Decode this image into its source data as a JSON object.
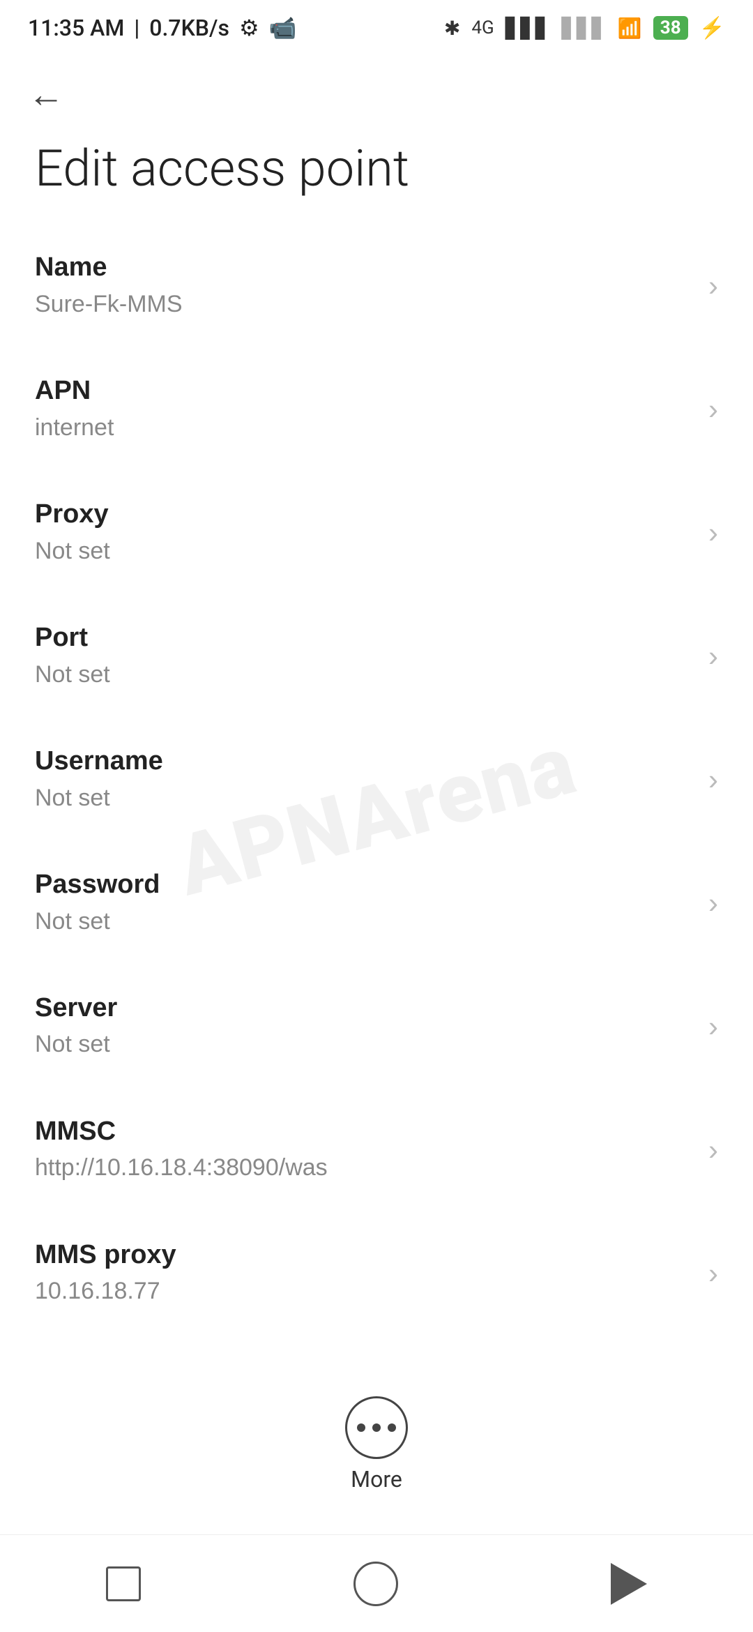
{
  "statusBar": {
    "time": "11:35 AM",
    "speed": "0.7KB/s",
    "battery": "38"
  },
  "header": {
    "backLabel": "←",
    "title": "Edit access point"
  },
  "fields": [
    {
      "label": "Name",
      "value": "Sure-Fk-MMS"
    },
    {
      "label": "APN",
      "value": "internet"
    },
    {
      "label": "Proxy",
      "value": "Not set"
    },
    {
      "label": "Port",
      "value": "Not set"
    },
    {
      "label": "Username",
      "value": "Not set"
    },
    {
      "label": "Password",
      "value": "Not set"
    },
    {
      "label": "Server",
      "value": "Not set"
    },
    {
      "label": "MMSC",
      "value": "http://10.16.18.4:38090/was"
    },
    {
      "label": "MMS proxy",
      "value": "10.16.18.77"
    }
  ],
  "more": {
    "label": "More"
  },
  "watermark": {
    "line1": "APNArena"
  }
}
